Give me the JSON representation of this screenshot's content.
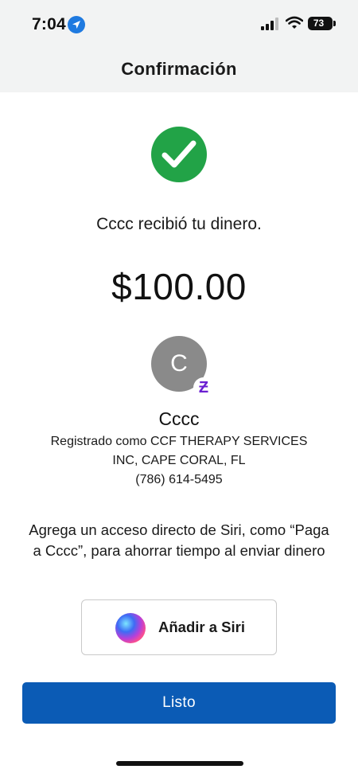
{
  "status_bar": {
    "time": "7:04",
    "battery": "73",
    "location_icon": "location-arrow-icon",
    "signal_icon": "cellular-signal-icon",
    "wifi_icon": "wifi-icon",
    "battery_icon": "battery-icon"
  },
  "nav": {
    "title": "Confirmación"
  },
  "confirmation": {
    "status_icon": "checkmark-circle-icon",
    "status_color": "#22a347",
    "message": "Cccc recibió tu dinero.",
    "amount": "$100.00"
  },
  "recipient": {
    "initial": "C",
    "badge_icon": "zelle-icon",
    "badge_glyph": "Ƶ",
    "badge_color": "#6b1fd1",
    "name": "Cccc",
    "registered_line1": "Registrado como CCF THERAPY SERVICES",
    "registered_line2": "INC, CAPE CORAL, FL",
    "phone": "(786) 614-5495"
  },
  "siri": {
    "prompt": "Agrega un acceso directo de Siri, como “Paga a Cccc”, para ahorrar tiempo al enviar dinero",
    "button_label": "Añadir a Siri",
    "button_icon": "siri-icon"
  },
  "done_button": {
    "label": "Listo",
    "color": "#0b5bb5"
  }
}
